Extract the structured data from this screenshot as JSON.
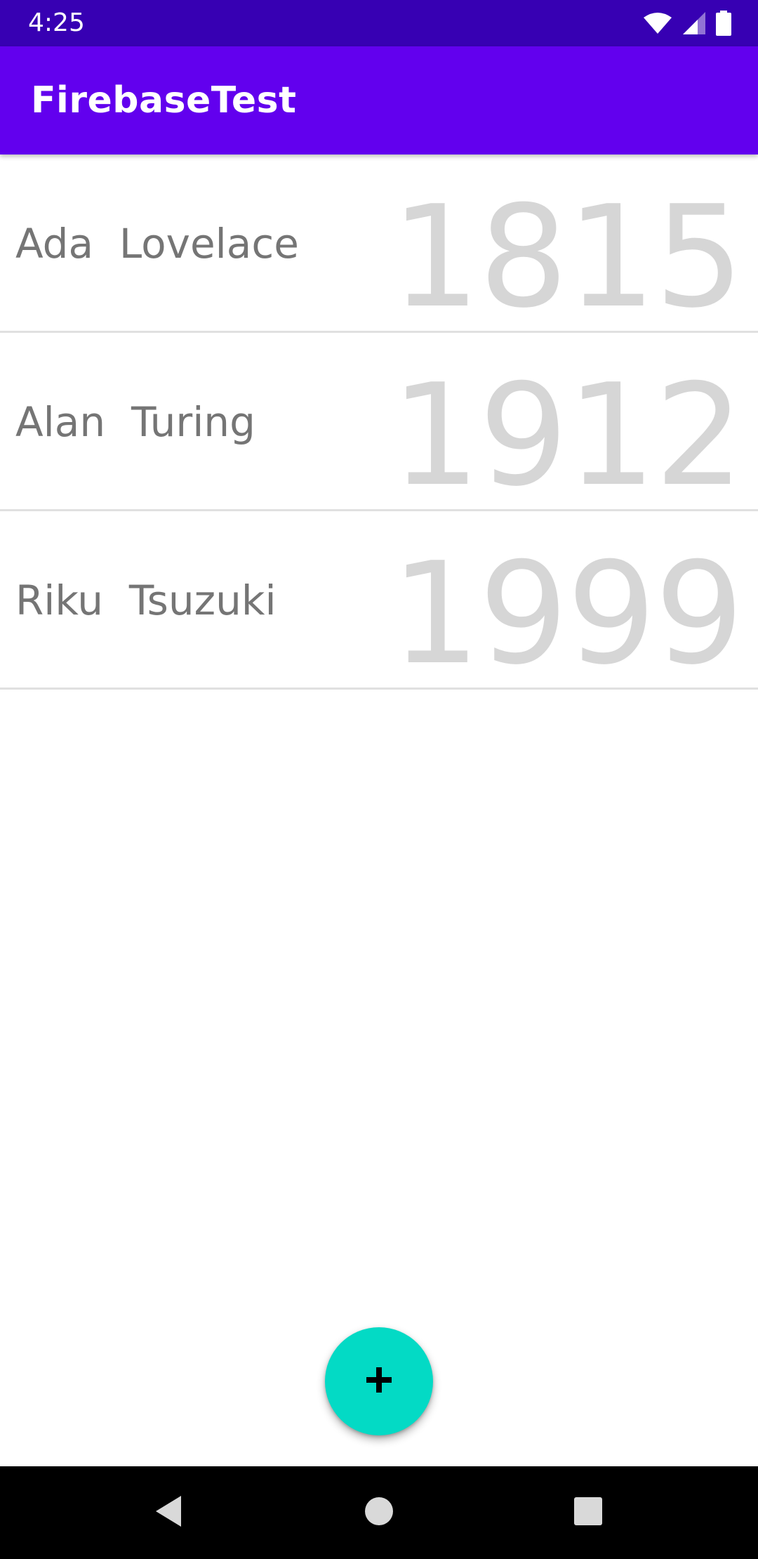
{
  "status_bar": {
    "time": "4:25",
    "icons": [
      "wifi-icon",
      "signal-icon",
      "battery-icon"
    ]
  },
  "app_bar": {
    "title": "FirebaseTest",
    "color": "#6200ee"
  },
  "list": {
    "items": [
      {
        "name": "Ada  Lovelace",
        "year": "1815"
      },
      {
        "name": "Alan  Turing",
        "year": "1912"
      },
      {
        "name": "Riku  Tsuzuki",
        "year": "1999"
      }
    ]
  },
  "fab": {
    "icon": "plus-icon",
    "color": "#03dac5"
  },
  "nav_bar": {
    "icons": [
      "back-icon",
      "home-icon",
      "recents-icon"
    ]
  }
}
